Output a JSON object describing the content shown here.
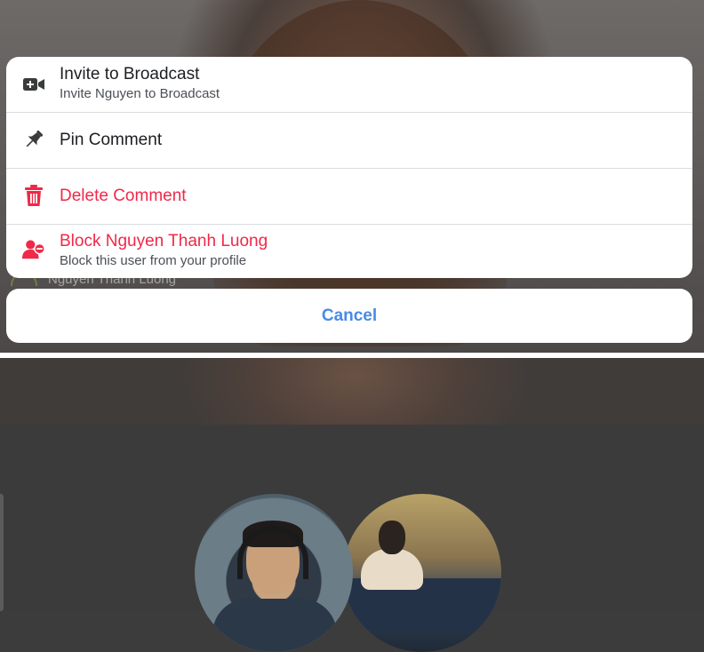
{
  "action_sheet": {
    "items": [
      {
        "title": "Invite to Broadcast",
        "subtitle": "Invite Nguyen to Broadcast",
        "icon": "video-plus-icon",
        "destructive": false
      },
      {
        "title": "Pin Comment",
        "icon": "pin-icon",
        "destructive": false
      },
      {
        "title": "Delete Comment",
        "icon": "trash-icon",
        "destructive": true
      },
      {
        "title": "Block Nguyen Thanh Luong",
        "subtitle": "Block this user from your profile",
        "icon": "block-user-icon",
        "destructive": true
      }
    ],
    "cancel_label": "Cancel"
  },
  "background": {
    "commenter_name": "Nguyen Thanh Luong"
  },
  "colors": {
    "destructive": "#f02849",
    "cancel": "#4a8ae8",
    "text_primary": "#1c1e21",
    "text_secondary": "#4b4f56",
    "icon_dark": "#3a3b3c"
  }
}
